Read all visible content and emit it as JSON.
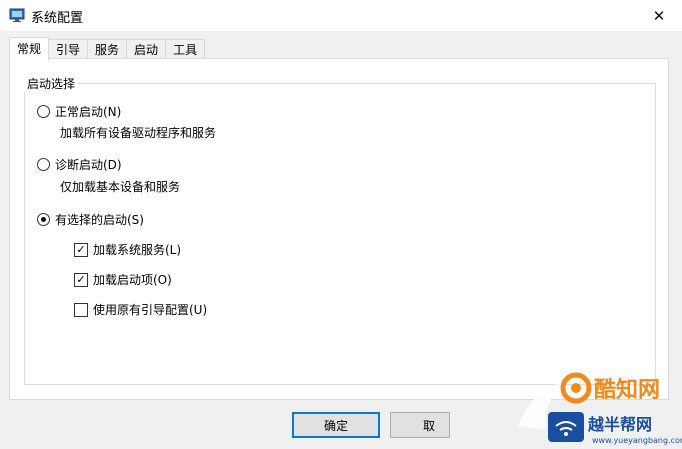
{
  "window": {
    "title": "系统配置",
    "close_glyph": "✕"
  },
  "tabs": [
    {
      "label": "常规",
      "active": true
    },
    {
      "label": "引导",
      "active": false
    },
    {
      "label": "服务",
      "active": false
    },
    {
      "label": "启动",
      "active": false
    },
    {
      "label": "工具",
      "active": false
    }
  ],
  "group": {
    "title": "启动选择",
    "normal": {
      "label": "正常启动(N)",
      "desc": "加载所有设备驱动程序和服务",
      "selected": false
    },
    "diagnostic": {
      "label": "诊断启动(D)",
      "desc": "仅加载基本设备和服务",
      "selected": false
    },
    "selective": {
      "label": "有选择的启动(S)",
      "selected": true,
      "options": [
        {
          "label": "加载系统服务(L)",
          "checked": true,
          "check_glyph": "✓"
        },
        {
          "label": "加载启动项(O)",
          "checked": true,
          "check_glyph": "✓"
        },
        {
          "label": "使用原有引导配置(U)",
          "checked": false,
          "check_glyph": ""
        }
      ]
    }
  },
  "buttons": {
    "ok": "确定",
    "cancel": "取"
  },
  "watermark": {
    "brand": "酷知网",
    "sub_brand": "越半帮网",
    "url": "www.yueyangbang.com"
  },
  "colors": {
    "accent": "#0078d7",
    "watermark_orange": "#f08a1c",
    "watermark_blue": "#1a4fa0"
  }
}
